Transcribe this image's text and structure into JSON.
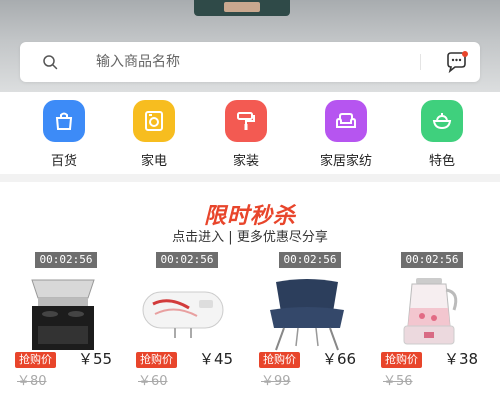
{
  "search": {
    "placeholder": "输入商品名称",
    "value": ""
  },
  "categories": [
    {
      "label": "百货",
      "icon": "shopping-bag-icon",
      "color": "#3d8bf7"
    },
    {
      "label": "家电",
      "icon": "washing-machine-icon",
      "color": "#f7bd1f"
    },
    {
      "label": "家装",
      "icon": "paint-roller-icon",
      "color": "#f35a52"
    },
    {
      "label": "家居家纺",
      "icon": "sofa-icon",
      "color": "#b655f0"
    },
    {
      "label": "特色",
      "icon": "bowl-icon",
      "color": "#3fd07d"
    }
  ],
  "flash_sale": {
    "title": "限时秒杀",
    "subtitle": "点击进入 | 更多优惠尽分享",
    "items": [
      {
        "timer": "00:02:56",
        "badge": "抢购价",
        "price": "￥55",
        "original": "￥80",
        "image": "range-hood-stove"
      },
      {
        "timer": "00:02:56",
        "badge": "抢购价",
        "price": "￥45",
        "original": "￥60",
        "image": "water-heater"
      },
      {
        "timer": "00:02:56",
        "badge": "抢购价",
        "price": "￥66",
        "original": "￥99",
        "image": "lounge-chair"
      },
      {
        "timer": "00:02:56",
        "badge": "抢购价",
        "price": "￥38",
        "original": "￥56",
        "image": "health-kettle"
      }
    ]
  },
  "colors": {
    "accent": "#e8452b",
    "timer_bg": "#6e6e6e",
    "message_dot": "#e8452b"
  }
}
